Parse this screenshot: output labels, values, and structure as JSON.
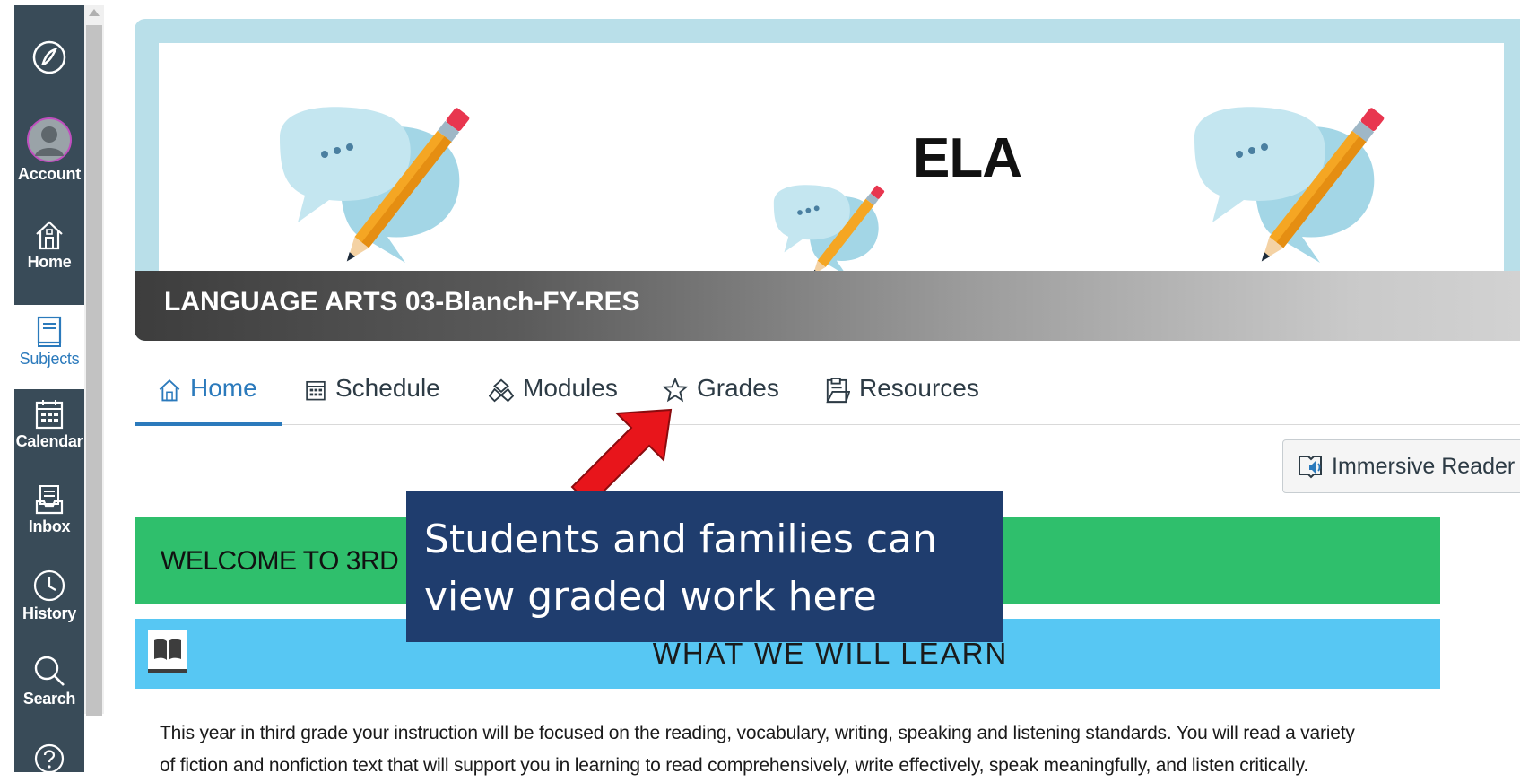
{
  "global_nav": {
    "items": [
      {
        "label": "",
        "icon": "canvas-logo-icon"
      },
      {
        "label": "Account",
        "icon": "avatar"
      },
      {
        "label": "Home",
        "icon": "home-icon"
      },
      {
        "label": "Subjects",
        "icon": "book-icon",
        "active": true
      },
      {
        "label": "Calendar",
        "icon": "calendar-icon"
      },
      {
        "label": "Inbox",
        "icon": "inbox-icon"
      },
      {
        "label": "History",
        "icon": "clock-icon"
      },
      {
        "label": "Search",
        "icon": "search-icon"
      },
      {
        "label": "",
        "icon": "help-icon"
      }
    ]
  },
  "banner": {
    "title": "ELA",
    "course_name": "LANGUAGE ARTS 03-Blanch-FY-RES"
  },
  "tabs": [
    {
      "label": "Home",
      "icon": "home-icon",
      "active": true
    },
    {
      "label": "Schedule",
      "icon": "calendar-icon"
    },
    {
      "label": "Modules",
      "icon": "modules-icon"
    },
    {
      "label": "Grades",
      "icon": "star-icon"
    },
    {
      "label": "Resources",
      "icon": "folder-icon"
    }
  ],
  "immersive_reader": {
    "label": "Immersive Reader",
    "icon": "immersive-reader-icon"
  },
  "content": {
    "welcome": "WELCOME TO 3RD",
    "learn_title": "WHAT WE WILL LEARN",
    "intro_line1": "This year in third grade your instruction will be focused on the reading, vocabulary, writing, speaking and listening standards. You will read a variety",
    "intro_line2": "of fiction and nonfiction text that will support you in learning to read comprehensively, write effectively, speak meaningfully, and listen critically."
  },
  "callout": {
    "line1": "Students and families can",
    "line2": "view graded work here"
  },
  "colors": {
    "nav_bg": "#394b58",
    "accent": "#2b7abc",
    "welcome_bg": "#2fbf6c",
    "learn_bg": "#57c7f3",
    "callout_bg": "#1f3d6e",
    "arrow": "#e8151b"
  }
}
